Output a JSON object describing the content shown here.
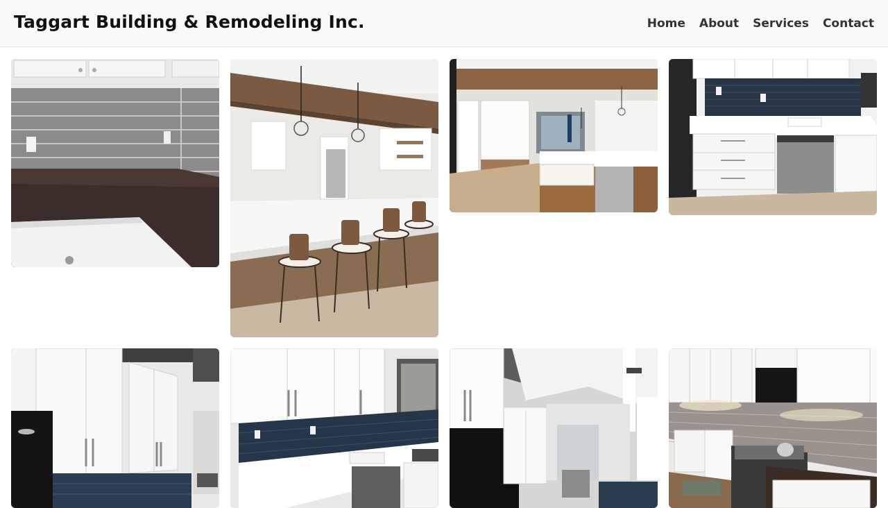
{
  "site": {
    "title": "Taggart Building & Remodeling Inc."
  },
  "nav": {
    "items": [
      {
        "label": "Home"
      },
      {
        "label": "About"
      },
      {
        "label": "Services"
      },
      {
        "label": "Contact"
      }
    ]
  },
  "gallery": {
    "images": [
      {
        "name": "photo-gray-subway-tile-backsplash-granite-corner",
        "scene": "gray glossy subway tile backsplash, dark granite countertop, white cabinets"
      },
      {
        "name": "photo-kitchen-island-wood-beam-barstools",
        "scene": "white quartz peninsula, wood ceiling beam, globe pendant lights, wood bar stools"
      },
      {
        "name": "photo-open-kitchen-farmhouse-sink-island",
        "scene": "white cabinets, farmhouse sink island with wood base, wood beam"
      },
      {
        "name": "photo-navy-tile-backsplash-dishwasher",
        "scene": "navy subway tile backsplash, white quartz counter, stainless dishwasher"
      },
      {
        "name": "photo-tall-white-cabinets-black-fridge",
        "scene": "tall white shaker cabinets, black refrigerator, navy tile"
      },
      {
        "name": "photo-white-cabinets-navy-backsplash-corner",
        "scene": "white upper cabinets, navy backsplash, white counter corner"
      },
      {
        "name": "photo-vaulted-ceiling-kitchen-black-fridge",
        "scene": "vaulted ceiling, white cabinets, black refrigerator"
      },
      {
        "name": "photo-gray-tile-kitchen-gas-range",
        "scene": "gray subway tile, under-cabinet lighting, stainless gas range"
      }
    ]
  },
  "colors": {
    "header_bg": "#f8f9fa",
    "title": "#111111",
    "nav_text": "#333333"
  }
}
